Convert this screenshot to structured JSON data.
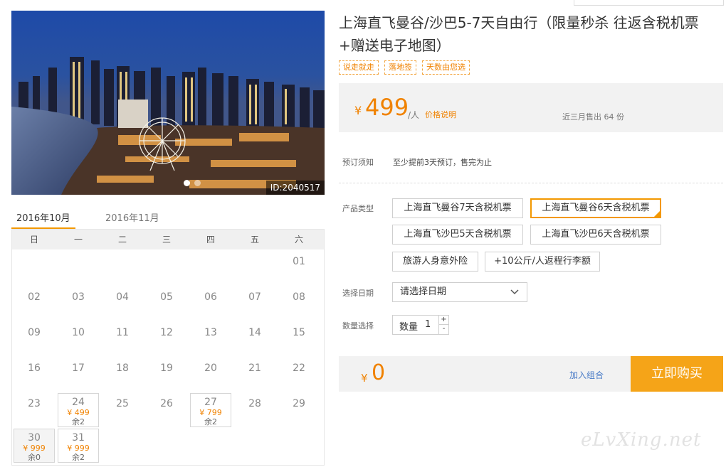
{
  "hero": {
    "image_id": "ID:2040517",
    "image_alt": "Bangkok riverside night skyline with Ferris wheel"
  },
  "calendar": {
    "tabs": [
      "2016年10月",
      "2016年11月"
    ],
    "active_tab": 0,
    "weekdays": [
      "日",
      "一",
      "二",
      "三",
      "四",
      "五",
      "六"
    ],
    "days": [
      {
        "d": "01",
        "col": 6,
        "row": 0
      },
      {
        "d": "02",
        "col": 0,
        "row": 1
      },
      {
        "d": "03",
        "col": 1,
        "row": 1
      },
      {
        "d": "04",
        "col": 2,
        "row": 1
      },
      {
        "d": "05",
        "col": 3,
        "row": 1
      },
      {
        "d": "06",
        "col": 4,
        "row": 1
      },
      {
        "d": "07",
        "col": 5,
        "row": 1
      },
      {
        "d": "08",
        "col": 6,
        "row": 1
      },
      {
        "d": "09",
        "col": 0,
        "row": 2
      },
      {
        "d": "10",
        "col": 1,
        "row": 2
      },
      {
        "d": "11",
        "col": 2,
        "row": 2
      },
      {
        "d": "12",
        "col": 3,
        "row": 2
      },
      {
        "d": "13",
        "col": 4,
        "row": 2
      },
      {
        "d": "14",
        "col": 5,
        "row": 2
      },
      {
        "d": "15",
        "col": 6,
        "row": 2
      },
      {
        "d": "16",
        "col": 0,
        "row": 3
      },
      {
        "d": "17",
        "col": 1,
        "row": 3
      },
      {
        "d": "18",
        "col": 2,
        "row": 3
      },
      {
        "d": "19",
        "col": 3,
        "row": 3
      },
      {
        "d": "20",
        "col": 4,
        "row": 3
      },
      {
        "d": "21",
        "col": 5,
        "row": 3
      },
      {
        "d": "22",
        "col": 6,
        "row": 3
      },
      {
        "d": "23",
        "col": 0,
        "row": 4
      },
      {
        "d": "24",
        "col": 1,
        "row": 4,
        "price": "¥ 499",
        "remain": "余2"
      },
      {
        "d": "25",
        "col": 2,
        "row": 4
      },
      {
        "d": "26",
        "col": 3,
        "row": 4
      },
      {
        "d": "27",
        "col": 4,
        "row": 4,
        "price": "¥ 799",
        "remain": "余2"
      },
      {
        "d": "28",
        "col": 5,
        "row": 4
      },
      {
        "d": "29",
        "col": 6,
        "row": 4
      },
      {
        "d": "30",
        "col": 0,
        "row": 5,
        "price": "¥ 999",
        "remain": "余0",
        "selected": true
      },
      {
        "d": "31",
        "col": 1,
        "row": 5,
        "price": "¥ 999",
        "remain": "余2"
      }
    ]
  },
  "product": {
    "title": "上海直飞曼谷/沙巴5-7天自由行（限量秒杀 往返含税机票+赠送电子地图）",
    "tags": [
      "说走就走",
      "落地签",
      "天数由您选"
    ]
  },
  "price": {
    "currency": "¥",
    "amount": "499",
    "unit": "/人",
    "note": "价格说明",
    "sold": "近三月售出 64 份"
  },
  "booking": {
    "notice_label": "预订须知",
    "notice_text": "至少提前3天预订，售完为止",
    "type_label": "产品类型",
    "options": [
      {
        "label": "上海直飞曼谷7天含税机票",
        "selected": false
      },
      {
        "label": "上海直飞曼谷6天含税机票",
        "selected": true
      },
      {
        "label": "上海直飞沙巴5天含税机票",
        "selected": false
      },
      {
        "label": "上海直飞沙巴6天含税机票",
        "selected": false
      },
      {
        "label": "旅游人身意外险",
        "selected": false
      },
      {
        "label": "+10公斤/人返程行李额",
        "selected": false
      }
    ],
    "date_label": "选择日期",
    "date_placeholder": "请选择日期",
    "qty_label": "数量选择",
    "qty_field_label": "数量",
    "qty_value": "1",
    "qty_plus": "+",
    "qty_minus": "-"
  },
  "total": {
    "currency": "¥",
    "amount": "0",
    "combo_link": "加入组合",
    "buy_button": "立即购买"
  },
  "watermark": "eLvXing.net",
  "colors": {
    "accent": "#f08200",
    "buy_button": "#f5a418",
    "link": "#4a7cc7"
  }
}
